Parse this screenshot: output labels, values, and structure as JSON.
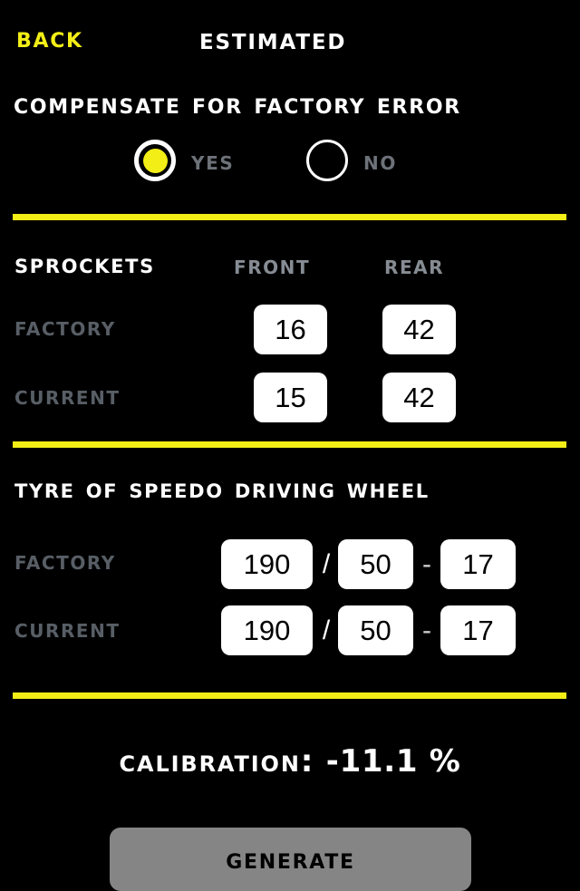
{
  "header": {
    "back_label": "Back",
    "title": "Estimated"
  },
  "compensate": {
    "question": "Compensate for factory error",
    "options": [
      {
        "label": "Yes",
        "selected": true
      },
      {
        "label": "No",
        "selected": false
      }
    ]
  },
  "sprockets": {
    "heading": "Sprockets",
    "columns": [
      "Front",
      "Rear"
    ],
    "rows": [
      {
        "label": "Factory",
        "front": "16",
        "rear": "42"
      },
      {
        "label": "Current",
        "front": "15",
        "rear": "42"
      }
    ]
  },
  "tyre": {
    "heading": "Tyre of speedo driving wheel",
    "separators": {
      "slash": "/",
      "dash": "-"
    },
    "rows": [
      {
        "label": "Factory",
        "width": "190",
        "aspect": "50",
        "rim": "17"
      },
      {
        "label": "Current",
        "width": "190",
        "aspect": "50",
        "rim": "17"
      }
    ]
  },
  "result": {
    "calibration_label": "Calibration:",
    "calibration_value": "-11.1 %"
  },
  "actions": {
    "generate_label": "Generate"
  },
  "colors": {
    "background": "#000000",
    "accent_yellow": "#f2ee16",
    "text_white": "#ffffff",
    "label_gray": "#585e65",
    "column_gray": "#868c93",
    "field_bg": "#ffffff",
    "button_gray": "#858585"
  }
}
